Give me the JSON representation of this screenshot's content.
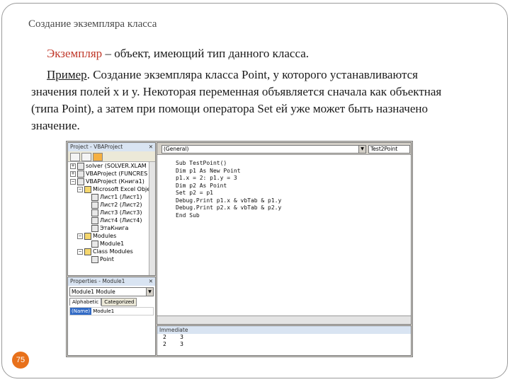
{
  "slide": {
    "title": "Создание экземпляра класса",
    "paragraph1": {
      "term": "Экземпляр",
      "rest": " – объект, имеющий тип данного класса."
    },
    "paragraph2": {
      "label": "Пример",
      "rest": ". Создание экземпляра класса Point, у которого устанавливаются значения полей x и y.  Некоторая переменная объявляется сначала как объектная (типа Point), а затем при помощи оператора Set ей уже может быть назначено значение."
    },
    "page_number": "75"
  },
  "vbe": {
    "project_pane_title": "Project - VBAProject",
    "tree": [
      "solver (SOLVER.XLAM",
      "VBAProject (FUNCRES",
      "VBAProject (Книга1)",
      "Microsoft Excel Obje",
      "Лист1 (Лист1)",
      "Лист2 (Лист2)",
      "Лист3 (Лист3)",
      "Лист4 (Лист4)",
      "ЭтаКнига",
      "Modules",
      "Module1",
      "Class Modules",
      "Point"
    ],
    "properties_pane_title": "Properties - Module1",
    "properties_combo": "Module1 Module",
    "properties_tabs": [
      "Alphabetic",
      "Categorized"
    ],
    "properties_row": {
      "key": "(Name)",
      "value": "Module1"
    },
    "code_combo_left": "(General)",
    "code_combo_right": "Test2Point",
    "code_lines": [
      "Sub TestPoint()",
      "Dim p1 As New Point",
      "p1.x = 2: p1.y = 3",
      "Dim p2 As Point",
      "Set p2 = p1",
      "Debug.Print p1.x & vbTab & p1.y",
      "Debug.Print p2.x & vbTab & p2.y",
      "End Sub"
    ],
    "immediate_title": "Immediate",
    "immediate_lines": [
      "2    3",
      "2    3"
    ]
  }
}
